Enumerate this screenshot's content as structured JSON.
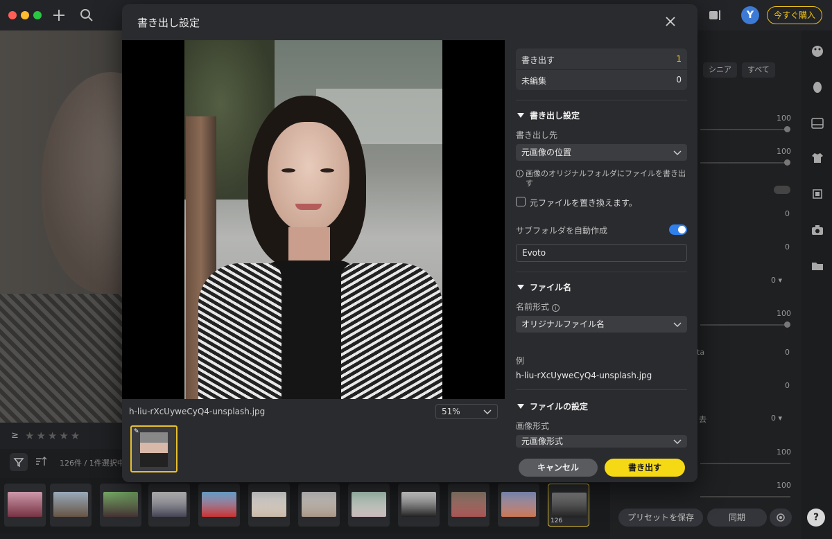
{
  "topbar": {
    "avatar_letter": "Y",
    "buy_label": "今すぐ購入"
  },
  "background": {
    "rating_symbol": "≥",
    "stars": "★★★★★",
    "count_text": "126件 / 1件選択中",
    "thumb_count": "126",
    "right_panel": {
      "chips": [
        "シニア",
        "すべて"
      ],
      "values": [
        "100",
        "100",
        "0",
        "0",
        "0 ▾",
        "100",
        "0",
        "0",
        "0 ▾",
        "100",
        "100"
      ],
      "partial_labels": [
        "ta",
        "去"
      ],
      "preset_label": "プリセットを保存",
      "sync_label": "同期"
    },
    "help_label": "?"
  },
  "dialog": {
    "title": "書き出し設定",
    "preview": {
      "filename": "h-liu-rXcUyweCyQ4-unsplash.jpg",
      "zoom": "51%"
    },
    "summary": {
      "export_label": "書き出す",
      "export_count": "1",
      "unedited_label": "未編集",
      "unedited_count": "0"
    },
    "export_settings": {
      "title": "書き出し設定",
      "destination_label": "書き出し先",
      "destination_value": "元画像の位置",
      "destination_note": "画像のオリジナルフォルダにファイルを書き出す",
      "replace_label": "元ファイルを置き換えます。",
      "subfolder_label": "サブフォルダを自動作成",
      "subfolder_value": "Evoto"
    },
    "file_name": {
      "title": "ファイル名",
      "format_label": "名前形式",
      "format_value": "オリジナルファイル名",
      "example_label": "例",
      "example_value": "h-liu-rXcUyweCyQ4-unsplash.jpg"
    },
    "file_settings": {
      "title": "ファイルの設定",
      "image_format_label": "画像形式",
      "image_format_value": "元画像形式"
    },
    "buttons": {
      "cancel": "キャンセル",
      "export": "書き出す"
    }
  },
  "colors": {
    "accent": "#f5d915",
    "toggle_on": "#2f80ed",
    "export_count": "#f0c419"
  },
  "icons": [
    "plus-icon",
    "search-icon",
    "close-icon",
    "chevron-down-icon",
    "info-icon",
    "filter-icon",
    "sort-icon",
    "gear-icon",
    "palette-icon",
    "face-icon",
    "shirt-icon",
    "crop-icon",
    "camera-icon",
    "folder-icon"
  ]
}
